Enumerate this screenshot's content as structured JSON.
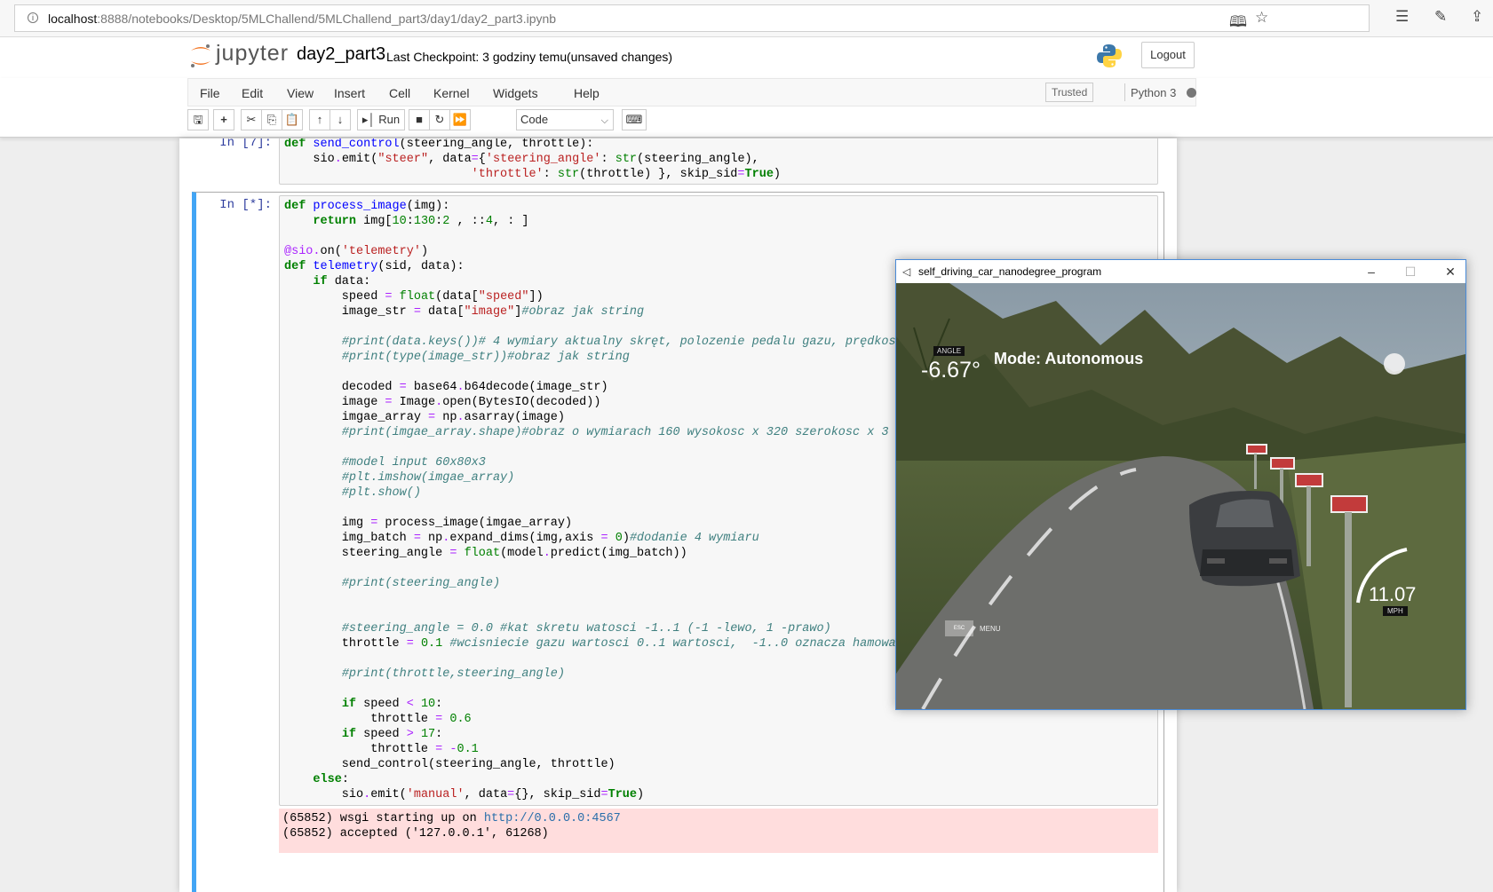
{
  "browser": {
    "url_host": "localhost",
    "url_path": ":8888/notebooks/Desktop/5MLChallend/5MLChallend_part3/day1/day2_part3.ipynb"
  },
  "header": {
    "logo_text": "jupyter",
    "notebook_name": "day2_part3",
    "checkpoint": "Last Checkpoint: 3 godziny temu",
    "unsaved": "(unsaved changes)",
    "logout": "Logout"
  },
  "menubar": {
    "items": [
      "File",
      "Edit",
      "View",
      "Insert",
      "Cell",
      "Kernel",
      "Widgets",
      "Help"
    ],
    "trusted": "Trusted",
    "kernel": "Python 3"
  },
  "toolbar": {
    "run_label": "Run",
    "cell_type": "Code"
  },
  "cells": {
    "cell1_prompt": "In [7]:",
    "cell2_prompt": "In [*]:",
    "output_line1_prefix": "(65852) wsgi starting up on ",
    "output_line1_link": "http://0.0.0.0:4567",
    "output_line2": "(65852) accepted ('127.0.0.1', 61268)"
  },
  "simulator": {
    "title": "self_driving_car_nanodegree_program",
    "angle_label": "ANGLE",
    "angle": "-6.67°",
    "mode": "Mode: Autonomous",
    "speed": "11.07",
    "speed_unit": "MPH",
    "menu": "MENU",
    "esc": "ESC"
  },
  "colors": {
    "prompt": "#303f9f",
    "selected_cell_border": "#42a5f5",
    "output_bg": "#ffdddd"
  }
}
